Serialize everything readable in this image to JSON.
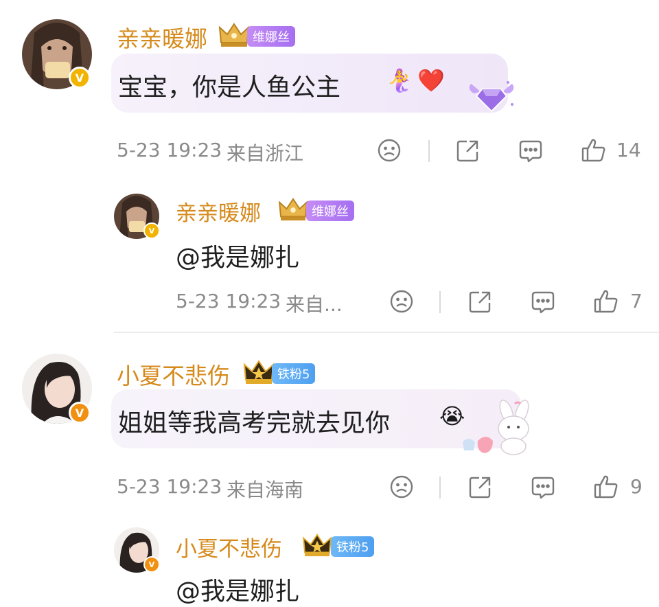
{
  "comments": [
    {
      "username": "亲亲暖娜",
      "badge": "维娜丝",
      "text": "宝宝，你是人鱼公主",
      "emoji_mermaid": "🧜‍♀️",
      "emoji_heart": "❤️",
      "time": "5-23 19:23",
      "location": "来自浙江",
      "likes": "14"
    },
    {
      "username": "亲亲暖娜",
      "badge": "维娜丝",
      "text": "@我是娜扎",
      "time": "5-23 19:23",
      "location": "来自...",
      "likes": "7"
    },
    {
      "username": "小夏不悲伤",
      "badge": "铁粉5",
      "text": "姐姐等我高考完就去见你",
      "emoji_cry": "😭",
      "time": "5-23 19:23",
      "location": "来自海南",
      "likes": "9"
    },
    {
      "username": "小夏不悲伤",
      "badge": "铁粉5",
      "text": "@我是娜扎"
    }
  ],
  "icons": {
    "dislike": "sad-face-icon",
    "share": "share-icon",
    "comment": "comment-icon",
    "like": "thumbs-up-icon",
    "verified": "verified-v-icon",
    "crown": "crown-icon",
    "diamond": "diamond-wings-icon",
    "bunny": "bunny-sticker-icon"
  },
  "colors": {
    "name": "#d68a1c",
    "badge_purple": "#b07cf2",
    "badge_blue": "#5aa8f2",
    "meta": "#8a8a8a",
    "verified": "#f2b400"
  }
}
